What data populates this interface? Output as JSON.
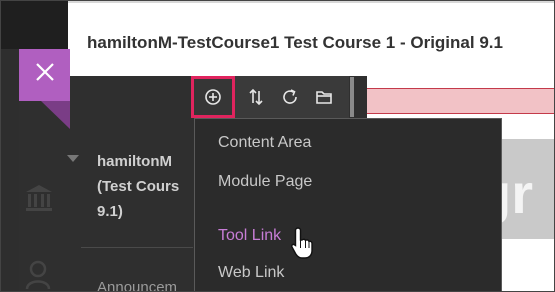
{
  "header": {
    "title": "hamiltonM-TestCourse1 Test Course 1 - Original 9.1"
  },
  "course_menu": {
    "course_name_lines": [
      "hamiltonM",
      "(Test Cours",
      "9.1)"
    ],
    "announcements_label": "Announcem"
  },
  "toolbar": {
    "buttons": [
      "add-icon",
      "sort-icon",
      "refresh-icon",
      "folder-icon"
    ]
  },
  "dropdown": {
    "items": [
      {
        "label": "Content Area",
        "active": false
      },
      {
        "label": "Module Page",
        "active": false
      },
      {
        "label": "Tool Link",
        "active": true
      },
      {
        "label": "Web Link",
        "active": false
      }
    ]
  },
  "background": {
    "partial_text": "gr"
  },
  "colors": {
    "accent_purple": "#b05fc0",
    "highlight_pink": "#e0245e",
    "menu_dark": "#2b2b2b",
    "active_item": "#c77dd6"
  }
}
